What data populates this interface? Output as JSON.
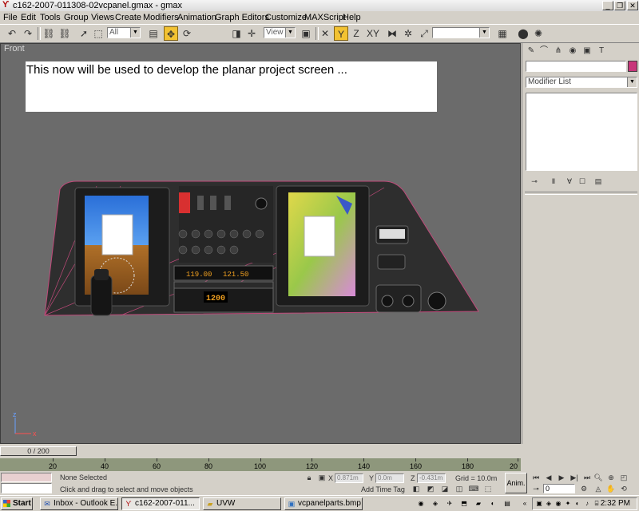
{
  "window": {
    "title": "c162-2007-011308-02vcpanel.gmax - gmax"
  },
  "menu": [
    "File",
    "Edit",
    "Tools",
    "Group",
    "Views",
    "Create",
    "Modifiers",
    "Animation",
    "Graph Editors",
    "Customize",
    "MAXScript",
    "Help"
  ],
  "toolbar": {
    "selection_filter": "All",
    "ref_coord": "View",
    "named_selection": ""
  },
  "viewport": {
    "label": "Front",
    "note": "This now will be used to develop the planar project screen ...",
    "axis": {
      "x": "x",
      "z": "z"
    },
    "panel": {
      "radio_freq": "119.00",
      "radio_stby": "121.50",
      "xpdr_code": "1200"
    }
  },
  "command_panel": {
    "object_name": "",
    "modifier_list": "Modifier List",
    "object_color": "#c8367a"
  },
  "timeline": {
    "slider": "0 / 200",
    "ticks": [
      "20",
      "40",
      "60",
      "80",
      "100",
      "120",
      "140",
      "160",
      "180",
      "20"
    ]
  },
  "status": {
    "selection": "None Selected",
    "prompt": "Click and drag to select and move objects",
    "x_label": "X",
    "x_value": "0.871m",
    "y_label": "Y",
    "y_value": "0.0m",
    "z_label": "Z",
    "z_value": "-0.431m",
    "grid": "Grid = 10.0m",
    "add_time_tag": "Add Time Tag",
    "anim": "Anim.",
    "frame": "0"
  },
  "taskbar": {
    "start": "Start",
    "tasks": [
      "Inbox - Outlook E...",
      "c162-2007-011...",
      "UVW",
      "vcpanelparts.bmp ..."
    ],
    "clock": "2:32 PM"
  }
}
